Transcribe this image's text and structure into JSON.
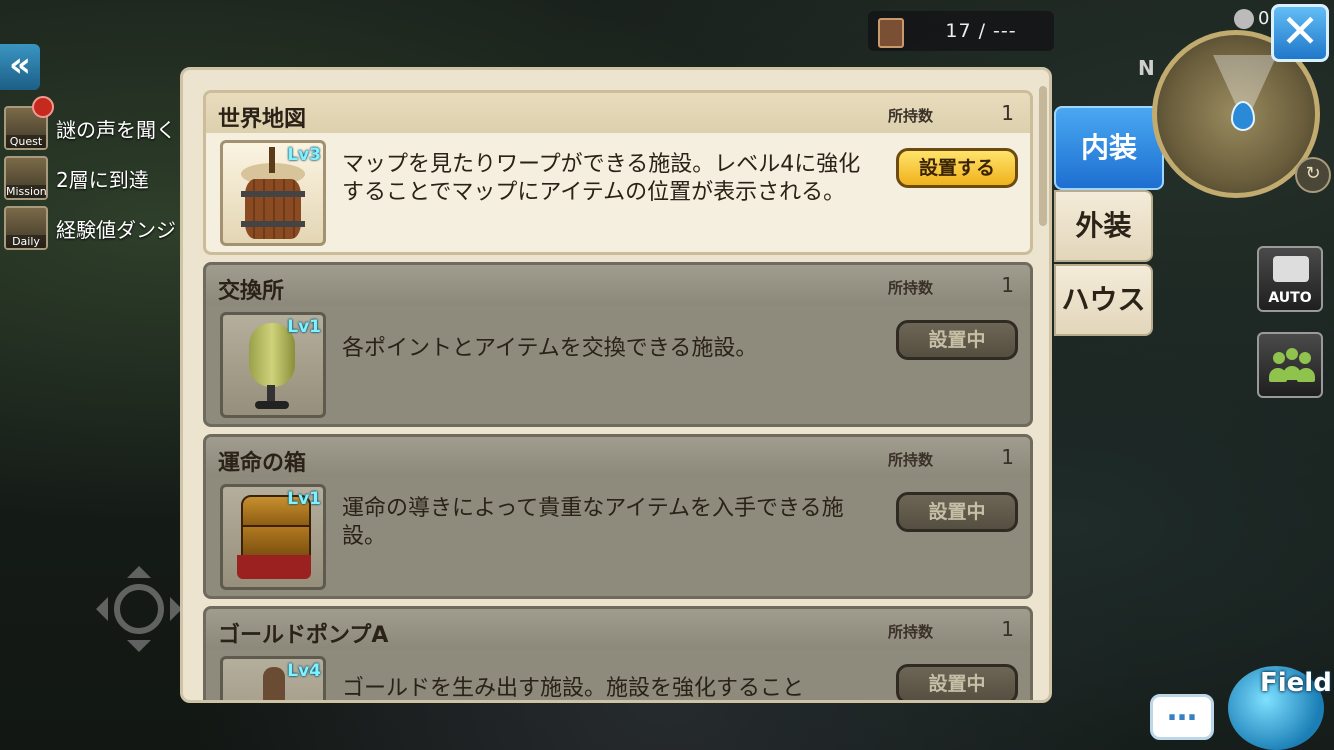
{
  "counter": {
    "value": "17 / ---"
  },
  "clock": {
    "value": "0"
  },
  "compass": {
    "north": "N"
  },
  "quests": [
    {
      "icon_label": "Quest",
      "text": "謎の声を聞く"
    },
    {
      "icon_label": "Mission",
      "text": "2層に到達"
    },
    {
      "icon_label": "Daily",
      "text": "経験値ダンジ"
    }
  ],
  "tabs": [
    {
      "label": "内装",
      "selected": true
    },
    {
      "label": "外装",
      "selected": false
    },
    {
      "label": "ハウス",
      "selected": false
    }
  ],
  "facilities": [
    {
      "name": "世界地図",
      "owned_label": "所持数",
      "owned": "1",
      "level": "Lv3",
      "description": "マップを見たりワープができる施設。レベル4に強化することでマップにアイテムの位置が表示される。",
      "button": "設置する",
      "state": "available",
      "art": "barrel"
    },
    {
      "name": "交換所",
      "owned_label": "所持数",
      "owned": "1",
      "level": "Lv1",
      "description": "各ポイントとアイテムを交換できる施設。",
      "button": "設置中",
      "state": "placed",
      "art": "machine"
    },
    {
      "name": "運命の箱",
      "owned_label": "所持数",
      "owned": "1",
      "level": "Lv1",
      "description": "運命の導きによって貴重なアイテムを入手できる施設。",
      "button": "設置中",
      "state": "placed",
      "art": "chest"
    },
    {
      "name": "ゴールドポンプA",
      "owned_label": "所持数",
      "owned": "1",
      "level": "Lv4",
      "description": "ゴールドを生み出す施設。施設を強化すること",
      "button": "設置中",
      "state": "placed",
      "art": "pump"
    }
  ],
  "side": {
    "auto_label": "AUTO",
    "field_label": "Field",
    "chat_label": "…"
  },
  "colors": {
    "tab_active": "#1d6fd0",
    "button_place": "#f0b21c",
    "panel_bg": "#ede4cf",
    "level_text": "#7ef2ff"
  },
  "icons": [
    "back-double-chevron-icon",
    "book-icon",
    "clock-icon",
    "close-icon",
    "rotate-icon",
    "camera-icon",
    "party-icon",
    "chat-icon",
    "joystick-icon"
  ]
}
